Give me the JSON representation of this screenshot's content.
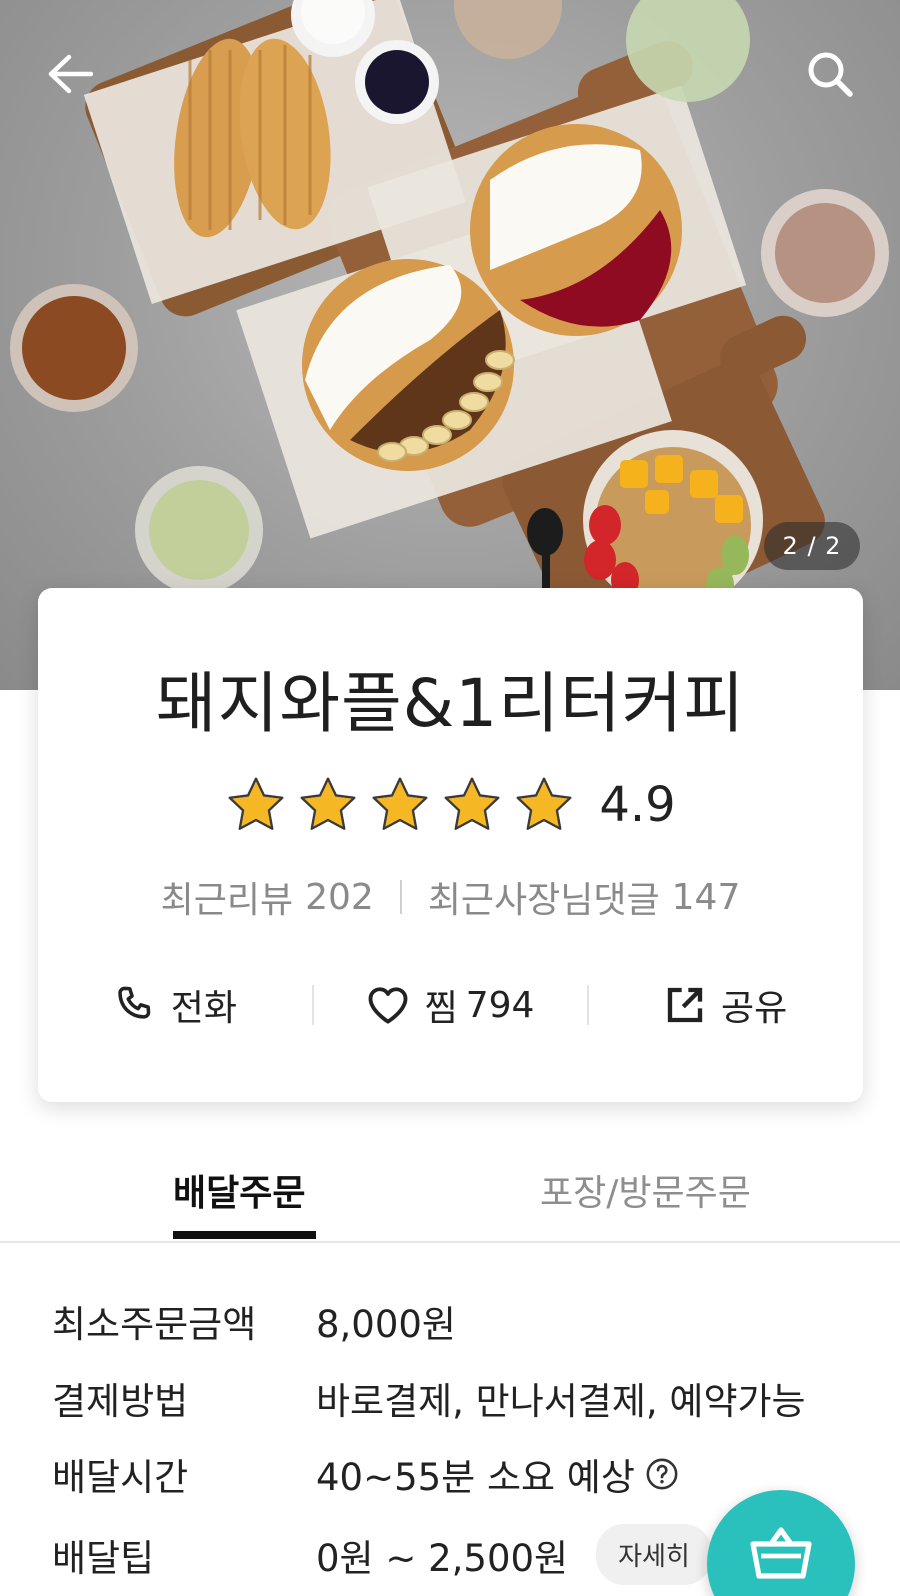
{
  "hero": {
    "page_counter": "2 / 2"
  },
  "store": {
    "name": "돼지와플&1리터커피",
    "rating": "4.9",
    "stars": 5,
    "recent_reviews_label": "최근리뷰",
    "recent_reviews_count": "202",
    "owner_replies_label": "최근사장님댓글",
    "owner_replies_count": "147"
  },
  "actions": {
    "call_label": "전화",
    "like_label": "찜",
    "like_count": "794",
    "share_label": "공유"
  },
  "tabs": [
    {
      "label": "배달주문",
      "active": true
    },
    {
      "label": "포장/방문주문",
      "active": false
    }
  ],
  "info": {
    "min_order_label": "최소주문금액",
    "min_order_value": "8,000원",
    "payment_label": "결제방법",
    "payment_value": "바로결제, 만나서결제, 예약가능",
    "delivery_time_label": "배달시간",
    "delivery_time_value": "40~55분 소요 예상",
    "delivery_tip_label": "배달팁",
    "delivery_tip_value": "0원 ~ 2,500원",
    "detail_button": "자세히"
  },
  "icons": [
    "back-arrow-icon",
    "search-icon",
    "star-icon",
    "phone-icon",
    "heart-icon",
    "share-icon",
    "help-icon",
    "cart-icon"
  ],
  "colors": {
    "accent": "#2ac1bc",
    "star": "#f5b824",
    "tab_active": "#111111",
    "muted_text": "#8a8a8a"
  }
}
